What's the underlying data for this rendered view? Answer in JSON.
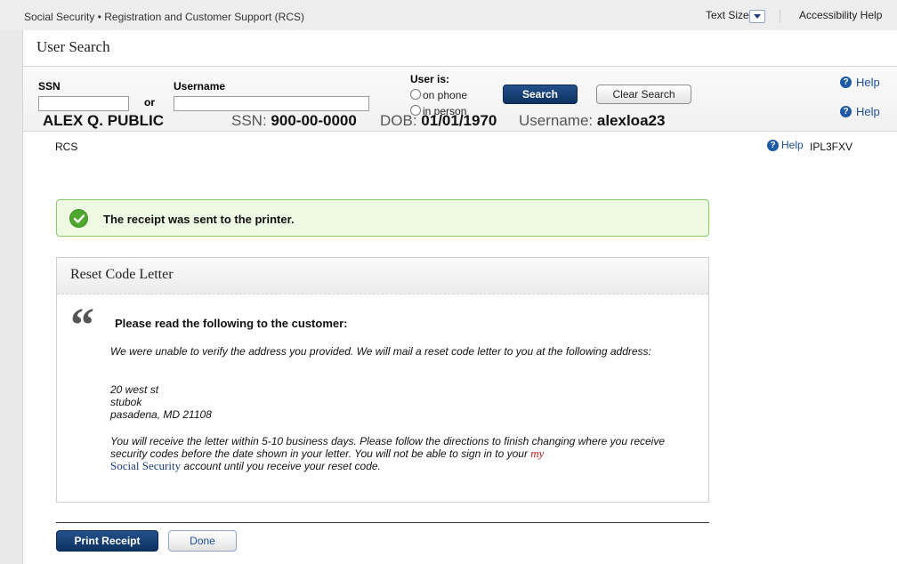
{
  "topbar": {
    "app_title": "Social Security • Registration and Customer Support (RCS)",
    "text_size_label": "Text Size",
    "accessibility_help": "Accessibility Help"
  },
  "user_search": {
    "title": "User Search",
    "ssn_label": "SSN",
    "or_label": "or",
    "username_label": "Username",
    "ssn_value": "",
    "username_value": "",
    "user_is_label": "User is:",
    "on_phone_label": "on phone",
    "in_person_label": "in person",
    "search_button": "Search",
    "clear_button": "Clear Search",
    "help_label": "Help"
  },
  "customer": {
    "name": "ALEX Q. PUBLIC",
    "ssn_label": "SSN:",
    "ssn": "900-00-0000",
    "dob_label": "DOB:",
    "dob": "01/01/1970",
    "username_label": "Username:",
    "username": "alexloa23",
    "help_label": "Help",
    "section": "RCS",
    "section_help": "Help",
    "code": "IPL3FXV"
  },
  "alert": {
    "message": "The receipt was sent to the printer."
  },
  "letter": {
    "title": "Reset Code Letter",
    "instruction": "Please read the following to the customer:",
    "para1": "We were unable to verify the address you provided. We will mail a reset code letter to you at the following address:",
    "address": [
      "20 west st",
      "stubok",
      "pasadena, MD 21108"
    ],
    "para3_part1": "You will receive the letter within 5-10 business days. Please follow the directions to finish changing where you receive security codes before the date shown in your letter. You will not be able to sign in to your",
    "para3_my": "my",
    "para3_ss": "Social Security",
    "para3_part2": "account until you receive your reset code."
  },
  "actions": {
    "print_receipt": "Print Receipt",
    "done": "Done"
  },
  "colors": {
    "primary_button": "#0e3261",
    "success_border": "#84cc63",
    "success_bg": "#eef9e4",
    "link_blue": "#1c4f99",
    "my_red": "#c01c1c"
  }
}
